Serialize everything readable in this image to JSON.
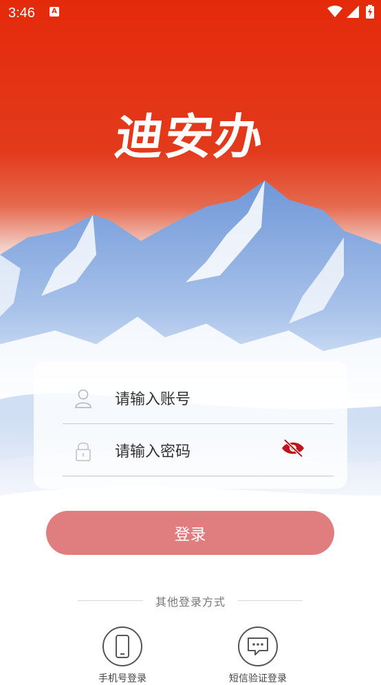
{
  "status_bar": {
    "time": "3:46",
    "notification_letter": "A"
  },
  "app": {
    "logo_text": "迪安办"
  },
  "login_form": {
    "account_placeholder": "请输入账号",
    "password_placeholder": "请输入密码",
    "login_label": "登录"
  },
  "other_login": {
    "label": "其他登录方式",
    "options": [
      {
        "label": "手机号登录",
        "icon": "smartphone-icon"
      },
      {
        "label": "短信验证登录",
        "icon": "message-icon"
      }
    ]
  },
  "colors": {
    "brand_red": "#e42a0b",
    "login_button": "#e07d7f",
    "eye_icon": "#c0141b"
  }
}
